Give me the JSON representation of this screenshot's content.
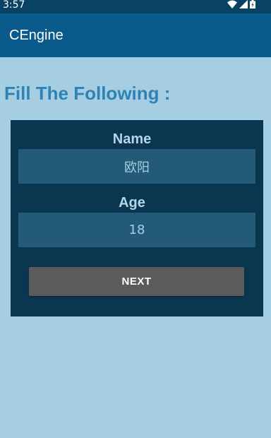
{
  "status_bar": {
    "time": "3:57",
    "icons": [
      "wifi-icon",
      "cellular-signal-icon",
      "battery-charging-icon"
    ]
  },
  "app_bar": {
    "title": "CEngine"
  },
  "form": {
    "heading": "Fill The Following :",
    "name_label": "Name",
    "name_value": "欧阳",
    "age_label": "Age",
    "age_value": "18",
    "next_label": "NEXT"
  },
  "colors": {
    "background": "#a6cee3",
    "status_bar": "#0a4264",
    "app_bar": "#0a5b8b",
    "heading": "#2f82b4",
    "card": "#0b3650",
    "input": "#235a78",
    "button": "#5b5b5b"
  }
}
